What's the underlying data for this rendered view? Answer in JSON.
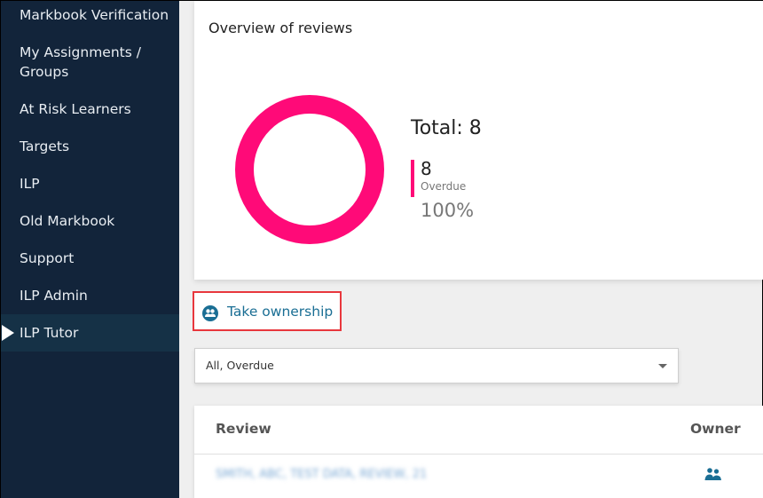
{
  "sidebar": {
    "items": [
      {
        "label": "Markbook Verification",
        "active": false
      },
      {
        "label": "My Assignments / Groups",
        "active": false
      },
      {
        "label": "At Risk Learners",
        "active": false
      },
      {
        "label": "Targets",
        "active": false
      },
      {
        "label": "ILP",
        "active": false
      },
      {
        "label": "Old Markbook",
        "active": false
      },
      {
        "label": "Support",
        "active": false
      },
      {
        "label": "ILP Admin",
        "active": false
      },
      {
        "label": "ILP Tutor",
        "active": true
      }
    ]
  },
  "overview": {
    "title": "Overview of reviews",
    "total_label": "Total: 8",
    "legend": {
      "count": "8",
      "label": "Overdue",
      "percent": "100%"
    },
    "colors": {
      "overdue": "#ff0a78"
    }
  },
  "chart_data": {
    "type": "pie",
    "title": "Overview of reviews",
    "categories": [
      "Overdue"
    ],
    "values": [
      8
    ],
    "total": 8,
    "percentages": [
      100
    ],
    "colors": [
      "#ff0a78"
    ]
  },
  "actions": {
    "take_ownership_label": "Take ownership"
  },
  "filter": {
    "value": "All, Overdue"
  },
  "table": {
    "columns": [
      "Review",
      "Owner"
    ],
    "rows": [
      {
        "review": "SMITH, ABC, TEST DATA, REVIEW, 21",
        "owner_icon": "users-icon"
      }
    ]
  }
}
